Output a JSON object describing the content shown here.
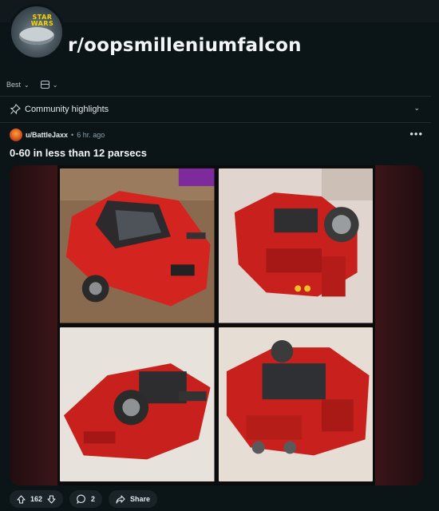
{
  "subreddit": {
    "name": "r/oopsmilleniumfalcon",
    "avatar_icon": "millennium-falcon-avatar-icon",
    "avatar_text": "STAR WARS"
  },
  "sort": {
    "label": "Best",
    "view_icon": "card-view-icon"
  },
  "highlights": {
    "label": "Community highlights"
  },
  "post": {
    "author": "u/BattleJaxx",
    "separator": "•",
    "time": "6 hr. ago",
    "title": "0-60 in less than 12 parsecs",
    "images": [
      {
        "icon": "red-lego-sports-car-photo"
      },
      {
        "icon": "red-lego-car-transforming-photo"
      },
      {
        "icon": "red-lego-car-wheel-side-photo"
      },
      {
        "icon": "red-lego-car-rear-photo"
      }
    ],
    "upvotes": "162",
    "comments": "2",
    "share_label": "Share"
  },
  "colors": {
    "background": "#0b1416",
    "button": "#1a2428",
    "lego_red": "#c8201c"
  }
}
